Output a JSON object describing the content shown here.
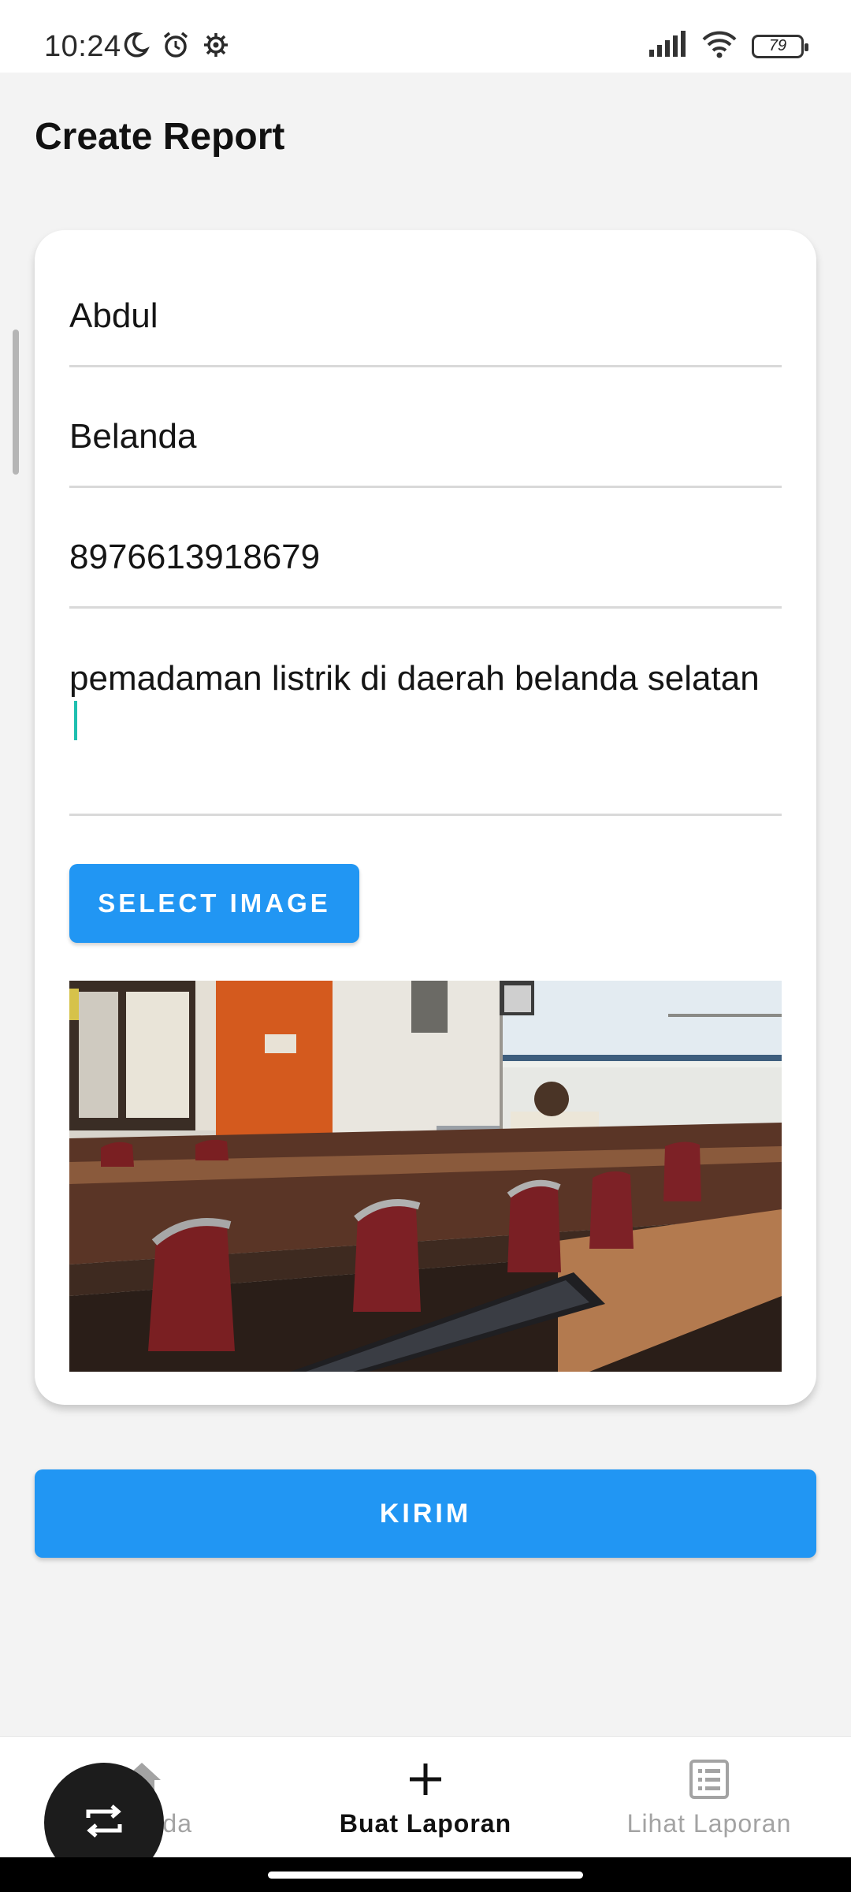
{
  "status_bar": {
    "time": "10:24",
    "battery": "79",
    "icons": [
      "moon-icon",
      "alarm-icon",
      "settings-gear-icon",
      "signal-icon",
      "wifi-icon",
      "battery-icon"
    ]
  },
  "page": {
    "title": "Create Report"
  },
  "form": {
    "name_value": "Abdul",
    "city_value": "Belanda",
    "phone_value": "8976613918679",
    "description_value": "pemadaman listrik di daerah belanda selatan",
    "select_image_label": "SELECT IMAGE"
  },
  "submit": {
    "label": "KIRIM"
  },
  "bottom_nav": {
    "items": [
      {
        "label": "Beranda",
        "icon": "home-icon",
        "active": false
      },
      {
        "label": "Buat Laporan",
        "icon": "add-icon",
        "active": true
      },
      {
        "label": "Lihat Laporan",
        "icon": "list-icon",
        "active": false
      }
    ]
  },
  "fab": {
    "icon": "swap-icon"
  },
  "colors": {
    "primary": "#2196f3",
    "background": "#f3f3f3",
    "cursor": "#1fbfb0",
    "inactive_nav": "#a3a3a3"
  }
}
